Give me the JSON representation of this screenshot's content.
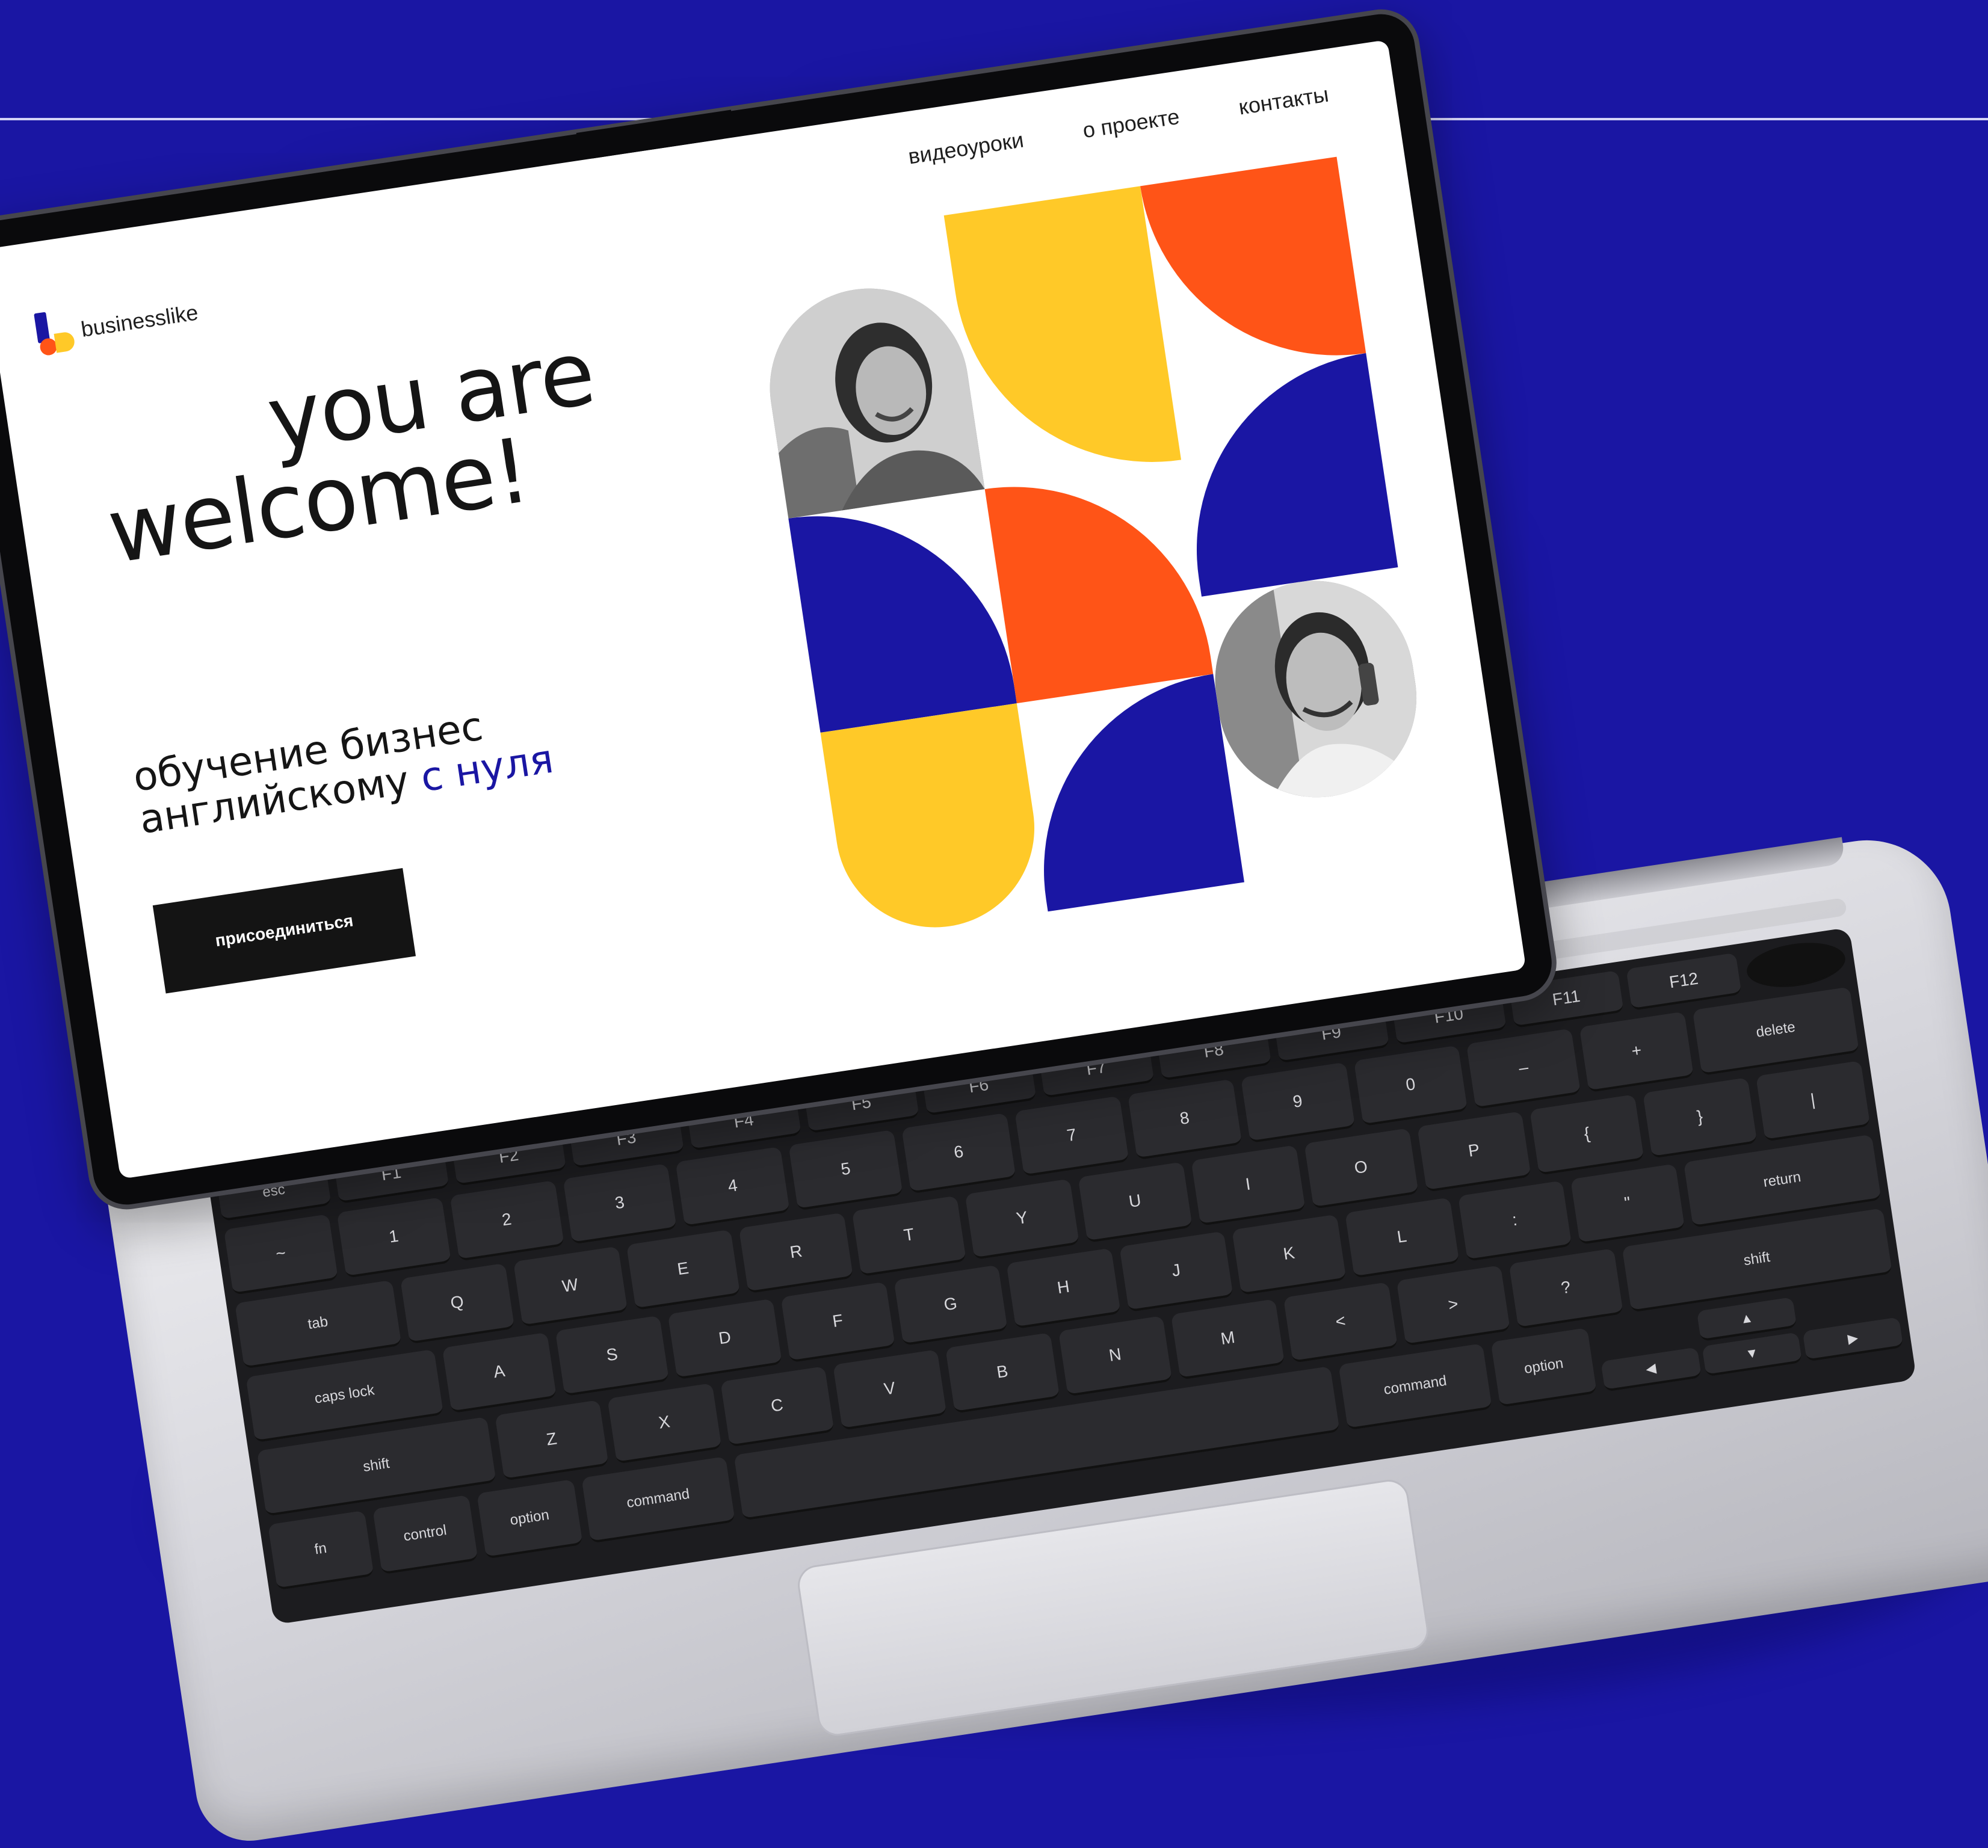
{
  "page": {
    "logo_text": "businesslike",
    "nav": [
      {
        "label": "видеоуроки"
      },
      {
        "label": "о проекте"
      },
      {
        "label": "контакты"
      }
    ],
    "hero": {
      "line1": "you are",
      "line2": "welcome!"
    },
    "subtitle": {
      "line1": "обучение бизнес",
      "line2_part1": "английскому ",
      "line2_accent": "с нуля"
    },
    "cta_label": "присоединиться"
  },
  "colors": {
    "background": "#1a16a3",
    "blue": "#1a16a3",
    "orange": "#ff5417",
    "yellow": "#ffc928",
    "text": "#151515"
  },
  "keyboard": {
    "fn_row": [
      "esc",
      "F1",
      "F2",
      "F3",
      "F4",
      "F5",
      "F6",
      "F7",
      "F8",
      "F9",
      "F10",
      "F11",
      "F12"
    ],
    "number_row": [
      "~",
      "1",
      "2",
      "3",
      "4",
      "5",
      "6",
      "7",
      "8",
      "9",
      "0",
      "–",
      "+",
      "delete"
    ],
    "top_row": [
      "tab",
      "Q",
      "W",
      "E",
      "R",
      "T",
      "Y",
      "U",
      "I",
      "O",
      "P",
      "{",
      "}",
      "|"
    ],
    "home_row": [
      "caps lock",
      "A",
      "S",
      "D",
      "F",
      "G",
      "H",
      "J",
      "K",
      "L",
      ":",
      "\"",
      "return"
    ],
    "bottom_row": [
      "shift",
      "Z",
      "X",
      "C",
      "V",
      "B",
      "N",
      "M",
      "<",
      ">",
      "?",
      "shift"
    ],
    "space_row": [
      "fn",
      "control",
      "option",
      "command",
      "",
      "command",
      "option"
    ],
    "arrows": [
      "▲",
      "◀",
      "▼",
      "▶"
    ]
  }
}
